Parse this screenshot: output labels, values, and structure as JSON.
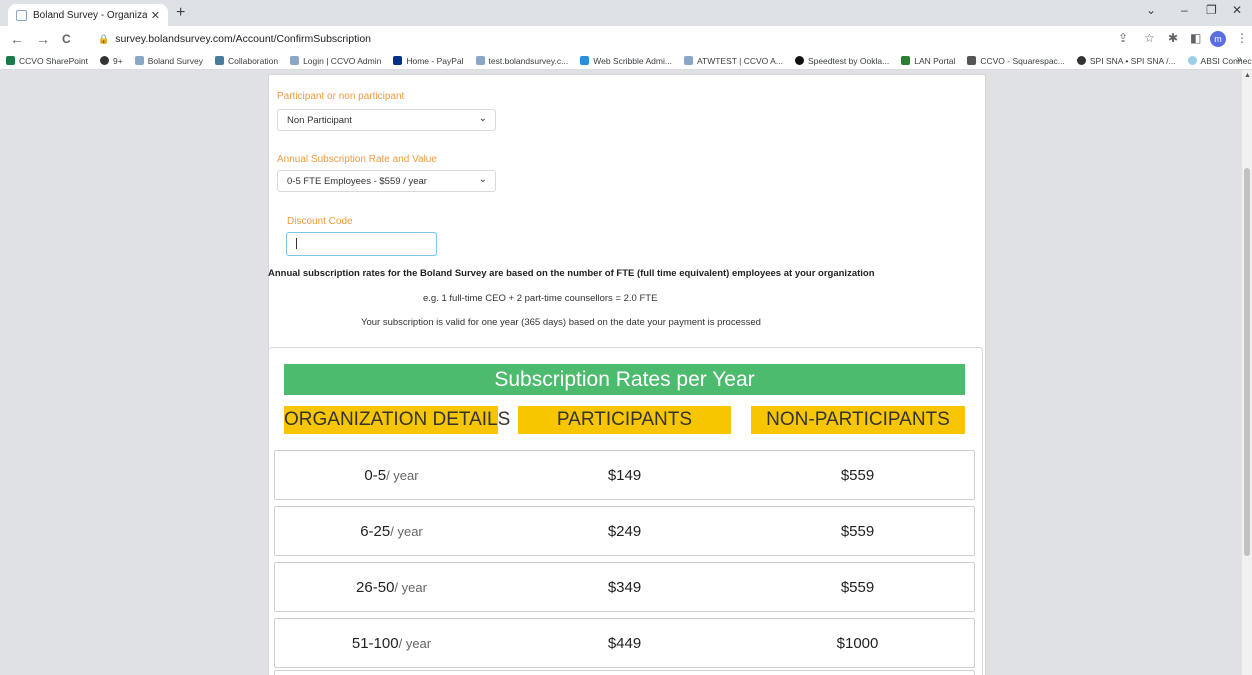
{
  "browser": {
    "tab_title": "Boland Survey - Organization Re",
    "tab_close": "✕",
    "new_tab": "+",
    "win_controls": {
      "dropdown": "⌄",
      "minimize": "–",
      "restore": "❐",
      "close": "✕"
    },
    "nav": {
      "back": "←",
      "forward": "→",
      "reload": "C"
    },
    "url": "survey.bolandsurvey.com/Account/ConfirmSubscription",
    "profile_initial": "m",
    "bookmarks": [
      "CCVO SharePoint",
      "9+",
      "Boland Survey",
      "Collaboration",
      "Login | CCVO Admin",
      "Home - PayPal",
      "test.bolandsurvey.c...",
      "Web Scribble Admi...",
      "ATWTEST | CCVO A...",
      "Speedtest by Ookla...",
      "LAN Portal",
      "CCVO - Squarespac...",
      "SPI SNA • SPI SNA /...",
      "ABSI Connect"
    ],
    "bookmarks_more": "»"
  },
  "form": {
    "participant_label": "Participant or non participant",
    "participant_value": "Non Participant",
    "rate_label": "Annual Subscription Rate and Value",
    "rate_value": "0-5 FTE Employees - $559 / year",
    "discount_label": "Discount Code",
    "discount_value": ""
  },
  "info": {
    "basis": "Annual subscription rates for the Boland Survey are based on the number of FTE (full time equivalent) employees at your organization",
    "example": "e.g. 1 full-time CEO + 2 part-time counsellors = 2.0 FTE",
    "validity": "Your subscription is valid for one year (365 days) based on the date your payment is processed"
  },
  "rates": {
    "title": "Subscription Rates per Year",
    "headers": [
      "ORGANIZATION DETAILS",
      "PARTICIPANTS",
      "NON-PARTICIPANTS"
    ],
    "unit": "/ year",
    "rows": [
      {
        "range": "0-5",
        "participants": "$149",
        "non_participants": "$559"
      },
      {
        "range": "6-25",
        "participants": "$249",
        "non_participants": "$559"
      },
      {
        "range": "26-50",
        "participants": "$349",
        "non_participants": "$559"
      },
      {
        "range": "51-100",
        "participants": "$449",
        "non_participants": "$1000"
      }
    ]
  },
  "colors": {
    "label_orange": "#f39a3d",
    "title_green": "#4dbb6e",
    "header_yellow": "#f7c600",
    "input_focus": "#7fc3e6"
  }
}
